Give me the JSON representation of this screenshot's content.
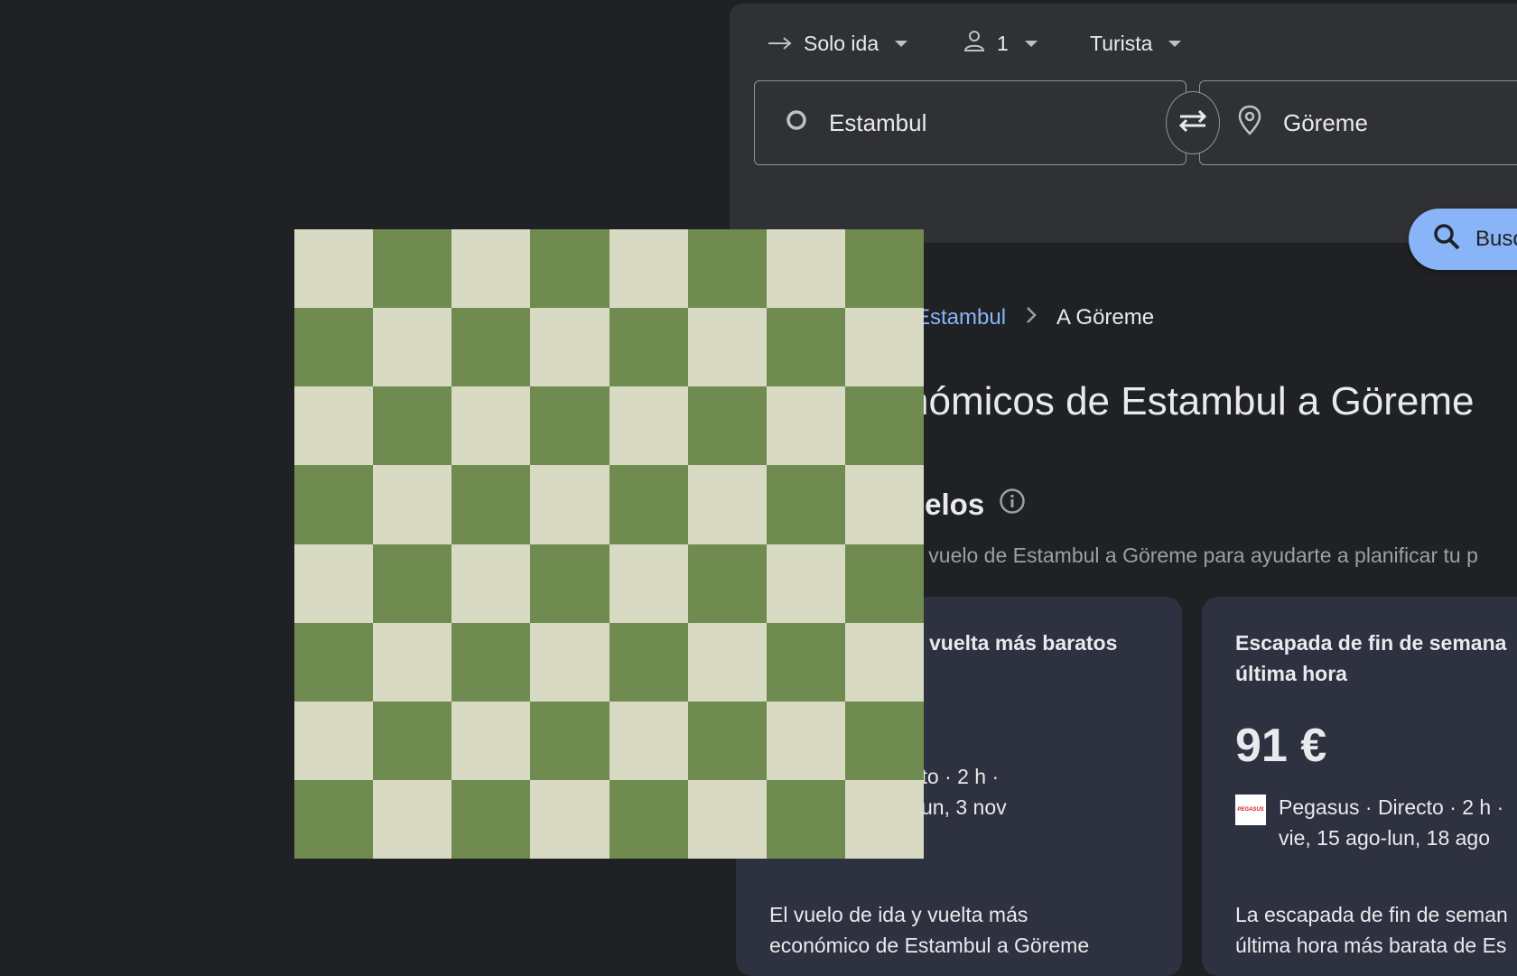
{
  "search": {
    "trip_type": "Solo ida",
    "passengers": "1",
    "cabin_class": "Turista",
    "origin": "Estambul",
    "destination": "Göreme",
    "search_button": "Busc"
  },
  "breadcrumb": {
    "link": "Estambul",
    "current": "A Göreme"
  },
  "page": {
    "title": "nómicos de Estambul a Göreme",
    "section_title": "uelos",
    "section_subtitle": "el vuelo de Estambul a Göreme para ayudarte a planificar tu p"
  },
  "cards": [
    {
      "title": "vuelta más baratos",
      "details_line1": "cto · 2 h ·",
      "details_line2": "un, 3 nov",
      "desc_line1": "El vuelo de ida y vuelta más",
      "desc_line2": "económico de Estambul a Göreme"
    },
    {
      "title_line1": "Escapada de fin de semana",
      "title_line2": "última hora",
      "price": "91 €",
      "airline_logo_text": "PEGASUS",
      "details_line1": "Pegasus · Directo · 2 h ·",
      "details_line2": "vie, 15 ago-lun, 18 ago",
      "desc_line1": "La escapada de fin de seman",
      "desc_line2": "última hora más barata de Es"
    }
  ],
  "colors": {
    "background": "#202124",
    "panel": "#303134",
    "card": "#2e3140",
    "accent": "#8ab4f8",
    "chess_light": "#d8dac3",
    "chess_dark": "#6f8b50"
  },
  "icons": [
    "arrow-right-icon",
    "person-icon",
    "circle-icon",
    "swap-icon",
    "pin-icon",
    "search-icon",
    "info-icon",
    "chevron-right-icon"
  ]
}
